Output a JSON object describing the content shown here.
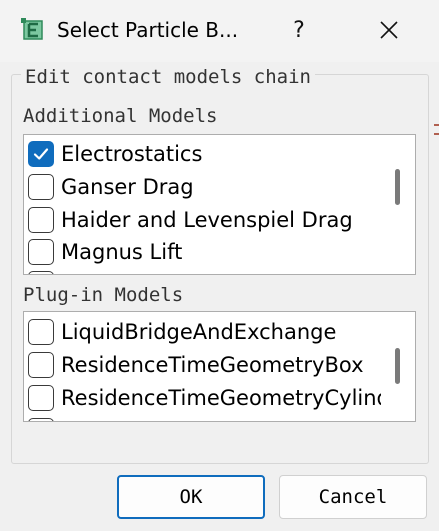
{
  "window": {
    "title": "Select Particle B...",
    "help_label": "?",
    "icons": {
      "app": "app-icon",
      "help": "help-icon",
      "close": "close-icon"
    }
  },
  "group": {
    "title": "Edit contact models chain"
  },
  "additional_models": {
    "label": "Additional Models",
    "items": [
      {
        "label": "Electrostatics",
        "checked": true
      },
      {
        "label": "Ganser Drag",
        "checked": false
      },
      {
        "label": "Haider and Levenspiel Drag",
        "checked": false
      },
      {
        "label": "Magnus Lift",
        "checked": false
      }
    ]
  },
  "plugin_models": {
    "label": "Plug-in Models",
    "items": [
      {
        "label": "LiquidBridgeAndExchange",
        "checked": false
      },
      {
        "label": "ResidenceTimeGeometryBox",
        "checked": false
      },
      {
        "label": "ResidenceTimeGeometryCylinder",
        "checked": false
      }
    ]
  },
  "buttons": {
    "ok": "OK",
    "cancel": "Cancel"
  },
  "colors": {
    "accent": "#0f6cbd",
    "window_bg": "#f0f0f0",
    "list_bg": "#ffffff"
  }
}
